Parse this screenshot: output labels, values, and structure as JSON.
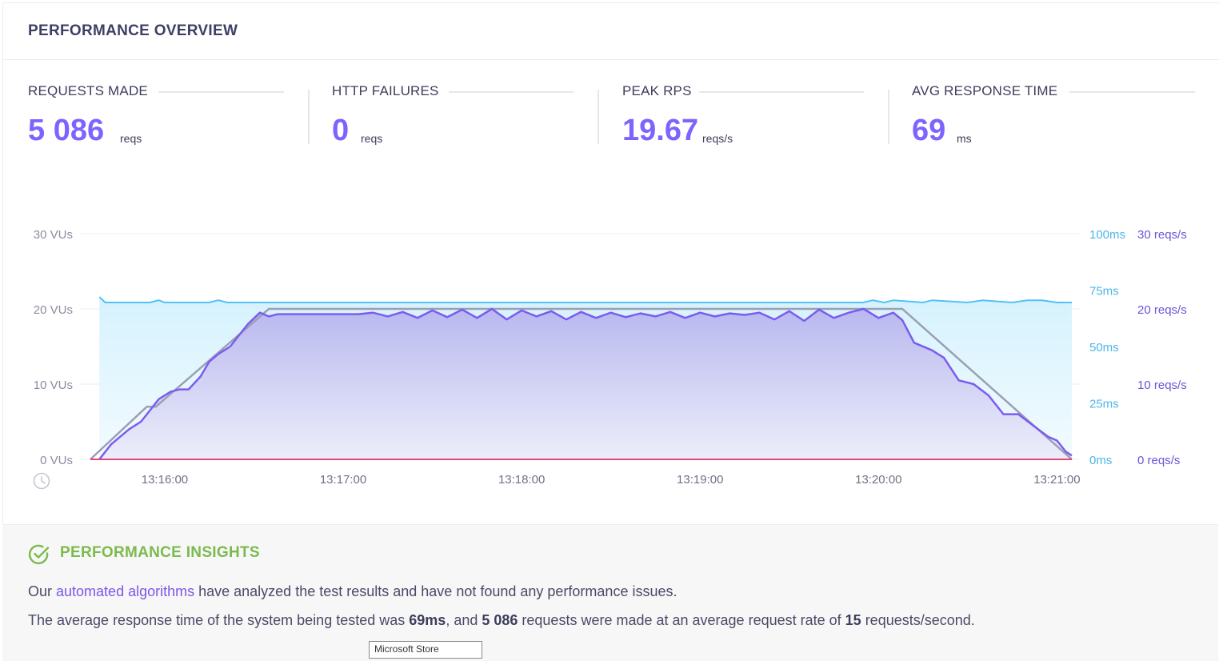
{
  "header": {
    "title": "PERFORMANCE OVERVIEW"
  },
  "stats": [
    {
      "label": "REQUESTS MADE",
      "value": "5 086",
      "unit": "reqs"
    },
    {
      "label": "HTTP FAILURES",
      "value": "0",
      "unit": "reqs"
    },
    {
      "label": "PEAK RPS",
      "value": "19.67",
      "unit": "reqs/s"
    },
    {
      "label": "AVG RESPONSE TIME",
      "value": "69",
      "unit": "ms"
    }
  ],
  "colors": {
    "accent": "#7d64ff",
    "vus_line": "#9aa0b4",
    "rps_line": "#7b5cf0",
    "response_line": "#4fc3f7",
    "failures_line": "#e8457a",
    "insights_green": "#7cba4c"
  },
  "chart_data": {
    "type": "line",
    "x_ticks": [
      "13:16:00",
      "13:17:00",
      "13:18:00",
      "13:19:00",
      "13:20:00",
      "13:21:00"
    ],
    "left_axis": {
      "label_ticks": [
        "0 VUs",
        "10 VUs",
        "20 VUs",
        "30 VUs"
      ],
      "range": [
        0,
        30
      ]
    },
    "right_axis_ms": {
      "label_ticks": [
        "0ms",
        "25ms",
        "50ms",
        "75ms",
        "100ms"
      ],
      "range": [
        0,
        100
      ]
    },
    "right_axis_rps": {
      "label_ticks": [
        "0 reqs/s",
        "10 reqs/s",
        "20 reqs/s",
        "30 reqs/s"
      ],
      "range": [
        0,
        30
      ]
    },
    "time_range": [
      "13:15:35",
      "13:21:05"
    ],
    "series": [
      {
        "axis": "vus",
        "x": [
          "13:15:35",
          "13:15:54",
          "13:15:57",
          "13:16:35",
          "13:20:08",
          "13:21:05"
        ],
        "values": [
          0,
          7,
          7,
          20,
          20,
          0
        ]
      },
      {
        "axis": "ms",
        "x": [
          "13:15:38",
          "13:15:40",
          "13:15:55",
          "13:15:58",
          "13:16:00",
          "13:16:15",
          "13:16:18",
          "13:16:21",
          "13:16:35",
          "13:19:55",
          "13:19:58",
          "13:20:02",
          "13:20:05",
          "13:20:15",
          "13:20:18",
          "13:20:30",
          "13:20:35",
          "13:20:45",
          "13:20:50",
          "13:20:55",
          "13:21:00",
          "13:21:05"
        ],
        "values": [
          72,
          69.5,
          69.5,
          70.5,
          69.5,
          69.5,
          70.5,
          69.5,
          69.5,
          69.5,
          70.5,
          69.5,
          70.5,
          69.5,
          70.5,
          69.5,
          70.5,
          69.5,
          70.5,
          70.5,
          69.5,
          69.5
        ]
      },
      {
        "axis": "rps",
        "x": [
          "13:15:38",
          "13:15:42",
          "13:15:48",
          "13:15:52",
          "13:15:55",
          "13:15:58",
          "13:16:02",
          "13:16:05",
          "13:16:08",
          "13:16:12",
          "13:16:15",
          "13:16:18",
          "13:16:22",
          "13:16:25",
          "13:16:28",
          "13:16:32",
          "13:16:35",
          "13:16:38",
          "13:16:42",
          "13:16:48",
          "13:16:55",
          "13:17:05",
          "13:17:10",
          "13:17:15",
          "13:17:20",
          "13:17:25",
          "13:17:30",
          "13:17:35",
          "13:17:40",
          "13:17:45",
          "13:17:50",
          "13:17:55",
          "13:18:00",
          "13:18:05",
          "13:18:10",
          "13:18:15",
          "13:18:20",
          "13:18:25",
          "13:18:30",
          "13:18:35",
          "13:18:40",
          "13:18:45",
          "13:18:50",
          "13:18:55",
          "13:19:00",
          "13:19:05",
          "13:19:10",
          "13:19:15",
          "13:19:20",
          "13:19:25",
          "13:19:30",
          "13:19:35",
          "13:19:40",
          "13:19:45",
          "13:19:50",
          "13:19:55",
          "13:20:00",
          "13:20:05",
          "13:20:08",
          "13:20:12",
          "13:20:18",
          "13:20:22",
          "13:20:27",
          "13:20:32",
          "13:20:37",
          "13:20:42",
          "13:20:47",
          "13:20:52",
          "13:20:57",
          "13:21:00",
          "13:21:03",
          "13:21:05"
        ],
        "values": [
          0,
          2,
          4,
          5,
          6.5,
          8,
          9,
          9.3,
          9.3,
          11,
          13,
          14,
          15,
          16.5,
          18,
          19.5,
          19,
          19.3,
          19.3,
          19.3,
          19.3,
          19.3,
          19.5,
          19,
          19.6,
          18.8,
          19.8,
          18.9,
          19.9,
          18.8,
          20,
          18.6,
          19.8,
          19,
          19.7,
          18.6,
          19.6,
          18.8,
          19.5,
          18.9,
          19.4,
          19,
          19.6,
          18.8,
          19.5,
          19,
          19.4,
          19.2,
          19.5,
          18.6,
          19.7,
          18.4,
          19.9,
          18.8,
          19.5,
          20,
          18.8,
          19.5,
          18.5,
          15.5,
          14.5,
          13.5,
          10.5,
          10,
          8.5,
          6,
          6,
          4.5,
          3,
          2.5,
          1,
          0.5
        ]
      },
      {
        "axis": "rps",
        "x": [
          "13:15:35",
          "13:21:05"
        ],
        "values": [
          0,
          0
        ]
      }
    ]
  },
  "insights": {
    "title": "PERFORMANCE INSIGHTS",
    "line1_pre": "Our ",
    "line1_link": "automated algorithms",
    "line1_post": " have analyzed the test results and have not found any performance issues.",
    "line2_a": "The average response time of the system being tested was ",
    "line2_b": "69ms",
    "line2_c": ", and ",
    "line2_d": "5 086",
    "line2_e": " requests were made at an average request rate of ",
    "line2_f": "15",
    "line2_g": " requests/second."
  },
  "tooltip": {
    "text": "Microsoft Store"
  }
}
